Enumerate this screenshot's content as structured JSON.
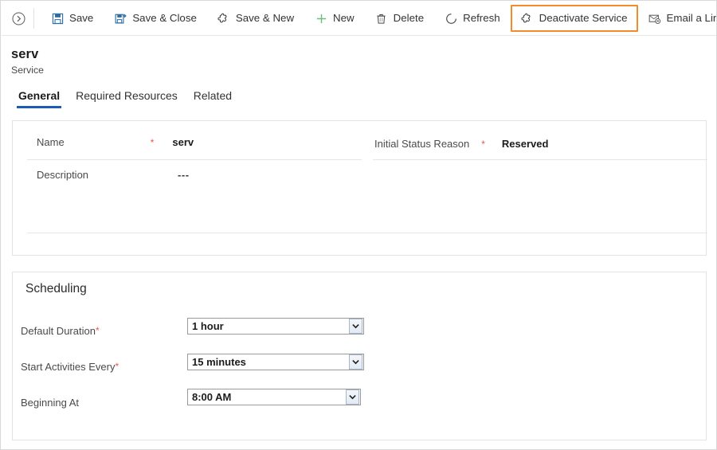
{
  "commandbar": {
    "expand_icon": "chevron-right-circle-icon",
    "buttons": [
      {
        "label": "Save",
        "icon": "save-floppy-icon",
        "highlighted": false
      },
      {
        "label": "Save & Close",
        "icon": "save-close-icon",
        "highlighted": false
      },
      {
        "label": "Save & New",
        "icon": "save-new-icon",
        "highlighted": false
      },
      {
        "label": "New",
        "icon": "plus-icon",
        "highlighted": false
      },
      {
        "label": "Delete",
        "icon": "trash-icon",
        "highlighted": false
      },
      {
        "label": "Refresh",
        "icon": "refresh-icon",
        "highlighted": false
      },
      {
        "label": "Deactivate Service",
        "icon": "deactivate-icon",
        "highlighted": true
      },
      {
        "label": "Email a Link",
        "icon": "email-link-icon",
        "highlighted": false
      }
    ],
    "overflow_icon": "more-vertical-icon",
    "highlight_color": "#f28b29"
  },
  "header": {
    "title": "serv",
    "subtitle": "Service"
  },
  "tabs": [
    {
      "label": "General",
      "active": true
    },
    {
      "label": "Required Resources",
      "active": false
    },
    {
      "label": "Related",
      "active": false
    }
  ],
  "general": {
    "name": {
      "label": "Name",
      "required": "*",
      "value": "serv"
    },
    "initial_status_reason": {
      "label": "Initial Status Reason",
      "required": "*",
      "value": "Reserved"
    },
    "description": {
      "label": "Description",
      "value": "---"
    }
  },
  "scheduling": {
    "heading": "Scheduling",
    "default_duration": {
      "label": "Default Duration",
      "required": "*",
      "value": "1 hour"
    },
    "start_activities_every": {
      "label": "Start Activities Every",
      "required": "*",
      "value": "15 minutes"
    },
    "beginning_at": {
      "label": "Beginning At",
      "required": "",
      "value": "8:00 AM"
    }
  }
}
